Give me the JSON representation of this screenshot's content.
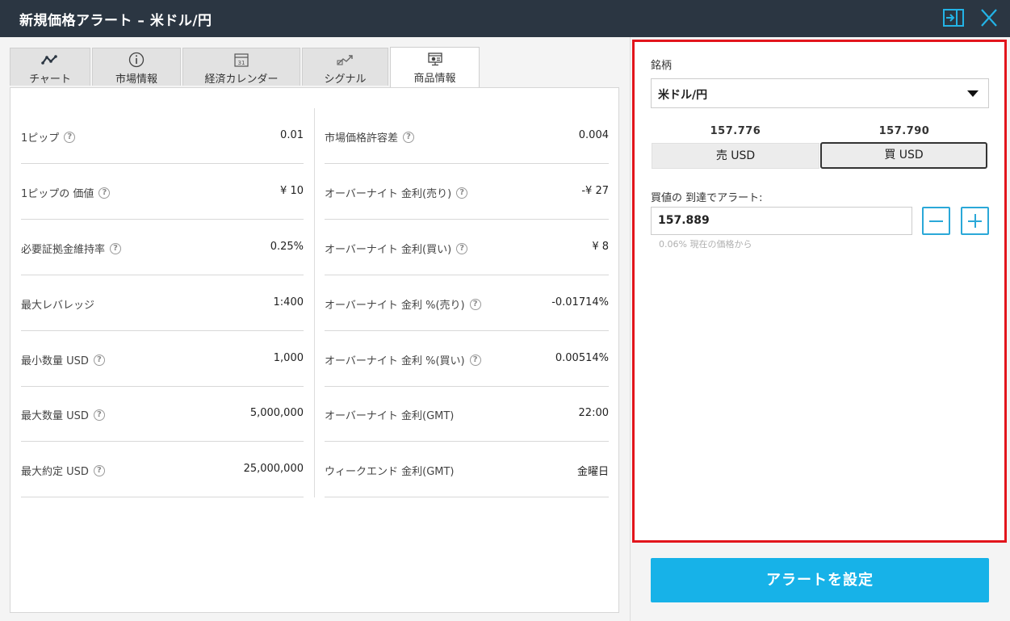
{
  "window": {
    "title": "新規価格アラート – 米ドル/円"
  },
  "tabs": [
    {
      "label": "チャート",
      "icon": "line-chart-icon"
    },
    {
      "label": "市場情報",
      "icon": "info-icon"
    },
    {
      "label": "経済カレンダー",
      "icon": "calendar-icon",
      "icon_text": "31"
    },
    {
      "label": "シグナル",
      "icon": "signal-icon"
    },
    {
      "label": "商品情報",
      "icon": "product-info-icon",
      "active": true
    }
  ],
  "product_info": {
    "left": [
      {
        "label": "1ピップ",
        "value": "0.01",
        "help": true
      },
      {
        "label": "1ピップの 価値",
        "value": "¥ 10",
        "help": true
      },
      {
        "label": "必要証拠金維持率",
        "value": "0.25%",
        "help": true
      },
      {
        "label": "最大レバレッジ",
        "value": "1:400",
        "help": false
      },
      {
        "label": "最小数量 USD",
        "value": "1,000",
        "help": true
      },
      {
        "label": "最大数量 USD",
        "value": "5,000,000",
        "help": true
      },
      {
        "label": "最大約定 USD",
        "value": "25,000,000",
        "help": true
      }
    ],
    "right": [
      {
        "label": "市場価格許容差",
        "value": "0.004",
        "help": true
      },
      {
        "label": "オーバーナイト 金利(売り)",
        "value": "-¥ 27",
        "help": true
      },
      {
        "label": "オーバーナイト 金利(買い)",
        "value": "¥ 8",
        "help": true
      },
      {
        "label": "オーバーナイト 金利 %(売り)",
        "value": "-0.01714%",
        "help": true
      },
      {
        "label": "オーバーナイト 金利 %(買い)",
        "value": "0.00514%",
        "help": true
      },
      {
        "label": "オーバーナイト 金利(GMT)",
        "value": "22:00",
        "help": false
      },
      {
        "label": "ウィークエンド 金利(GMT)",
        "value": "金曜日",
        "help": false
      }
    ]
  },
  "alert": {
    "symbol_label": "銘柄",
    "symbol_value": "米ドル/円",
    "sell_price": "157.776",
    "buy_price": "157.790",
    "sell_label": "売 USD",
    "buy_label": "買 USD",
    "rate_label": "買値の 到達でアラート:",
    "rate_value": "157.889",
    "hint": "0.06% 現在の価格から",
    "submit_label": "アラートを設定"
  },
  "colors": {
    "accent": "#17b2e8",
    "titlebar": "#2b3642",
    "highlight": "#e2151c"
  }
}
